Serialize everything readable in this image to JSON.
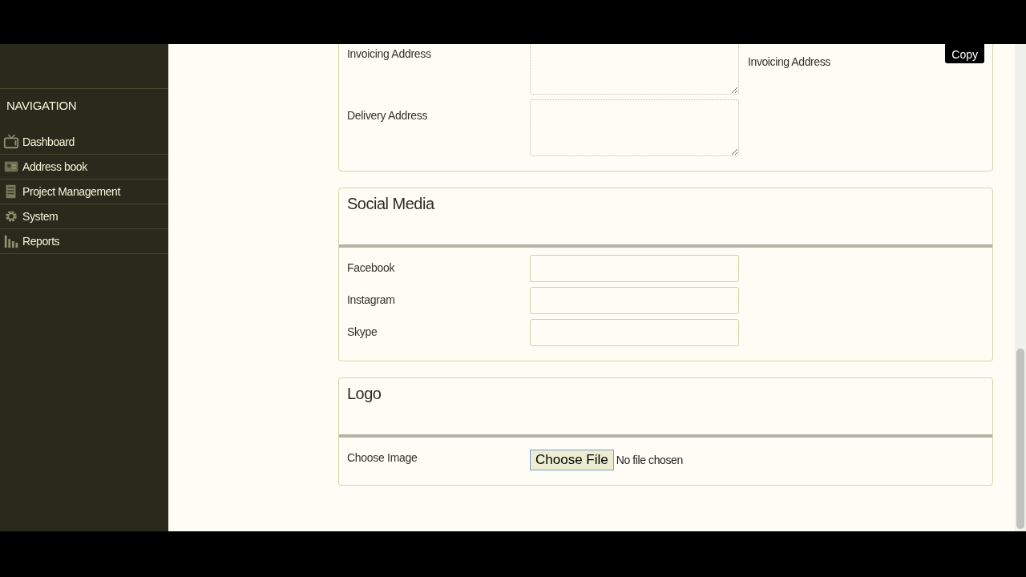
{
  "sidebar": {
    "heading": "NAVIGATION",
    "items": [
      {
        "label": "Dashboard"
      },
      {
        "label": "Address book"
      },
      {
        "label": "Project Management"
      },
      {
        "label": "System"
      },
      {
        "label": "Reports"
      }
    ]
  },
  "sections": [
    {
      "kind": "address",
      "rows": [
        {
          "label": "Invoicing Address",
          "kind": "textarea"
        },
        {
          "label": "Delivery Address",
          "kind": "textarea"
        }
      ],
      "side_text": "Invoicing Address",
      "side_button": "Copy"
    },
    {
      "kind": "titled",
      "title": "Social Media",
      "rows": [
        {
          "label": "Facebook",
          "kind": "input"
        },
        {
          "label": "Instagram",
          "kind": "input"
        },
        {
          "label": "Skype",
          "kind": "input"
        }
      ]
    },
    {
      "kind": "titled",
      "title": "Logo",
      "rows": [
        {
          "label": "Choose Image",
          "kind": "file",
          "button": "Choose File",
          "status": "No file chosen"
        }
      ]
    }
  ]
}
